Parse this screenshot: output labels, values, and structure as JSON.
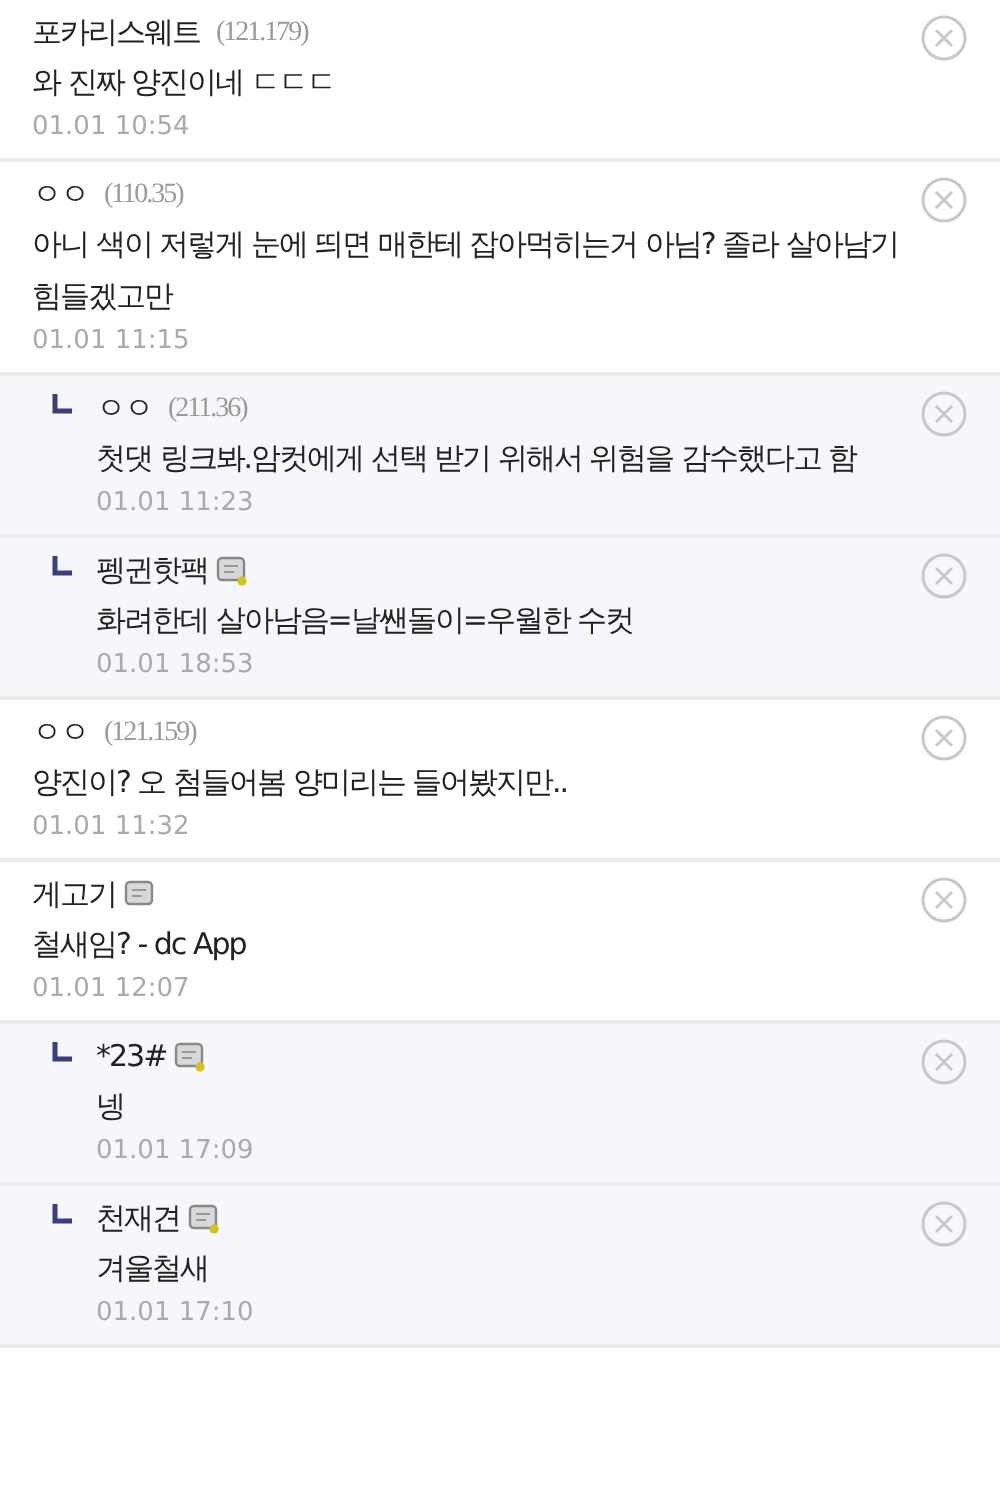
{
  "comments": [
    {
      "kind": "comment",
      "name": "포카리스웨트",
      "ip": "(121.179)",
      "text": "와 진짜 양진이네 ㄷㄷㄷ",
      "time": "01.01 10:54"
    },
    {
      "kind": "comment",
      "name": "ㅇㅇ",
      "ip": "(110.35)",
      "text": "아니 색이 저렇게 눈에 띄면 매한테 잡아먹히는거 아님? 졸라 살아남기 힘들겠고만",
      "time": "01.01 11:15"
    },
    {
      "kind": "reply",
      "name": "ㅇㅇ",
      "ip": "(211.36)",
      "text": "첫댓 링크봐.암컷에게 선택 받기 위해서 위험을 감수했다고 함",
      "time": "01.01 11:23"
    },
    {
      "kind": "reply",
      "name": "펭귄핫팩",
      "gallery_icon": true,
      "icon_dot": true,
      "text": "화려한데 살아남음=날쌘돌이=우월한 수컷",
      "time": "01.01 18:53"
    },
    {
      "kind": "comment",
      "name": "ㅇㅇ",
      "ip": "(121.159)",
      "text": "양진이? 오 첨들어봄 양미리는 들어봤지만..",
      "time": "01.01 11:32"
    },
    {
      "kind": "comment",
      "name": "게고기",
      "gallery_icon": true,
      "icon_dot": false,
      "text": "철새임? - dc App",
      "time": "01.01 12:07"
    },
    {
      "kind": "reply",
      "name": "*23#",
      "gallery_icon": true,
      "icon_dot": true,
      "text": "넹",
      "time": "01.01 17:09"
    },
    {
      "kind": "reply",
      "name": "천재견",
      "gallery_icon": true,
      "icon_dot": true,
      "text": "겨울철새",
      "time": "01.01 17:10"
    }
  ]
}
